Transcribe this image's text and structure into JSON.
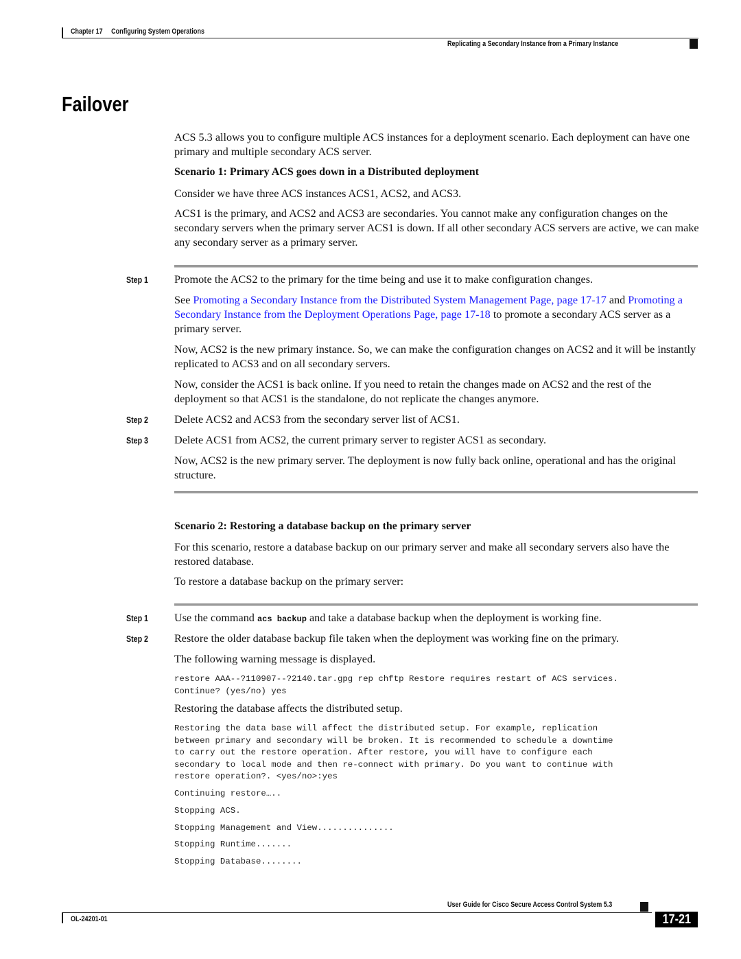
{
  "header": {
    "chapter": "Chapter 17",
    "chapter_title": "Configuring System Operations",
    "section_title": "Replicating a Secondary Instance from a Primary Instance"
  },
  "title": "Failover",
  "intro": "ACS 5.3 allows you to configure multiple ACS instances for a deployment scenario. Each deployment can have one primary and multiple secondary ACS server.",
  "scenario1": {
    "heading": "Scenario 1: Primary ACS goes down in a Distributed deployment",
    "p1": "Consider we have three ACS instances ACS1, ACS2, and ACS3.",
    "p2": "ACS1 is the primary, and ACS2 and ACS3 are secondaries. You cannot make any configuration changes on the secondary servers when the primary server ACS1 is down. If all other secondary ACS servers are active, we can make any secondary server as a primary server.",
    "steps": [
      {
        "label": "Step 1",
        "text": "Promote the ACS2 to the primary for the time being and use it to make configuration changes."
      },
      {
        "label": "Step 2",
        "text": "Delete ACS2 and ACS3 from the secondary server list of ACS1."
      },
      {
        "label": "Step 3",
        "text": "Delete ACS1 from ACS2, the current primary server to register ACS1 as secondary."
      }
    ],
    "see_prefix": "See ",
    "link1": "Promoting a Secondary Instance from the Distributed System Management Page, page 17-17",
    "see_and": " and ",
    "link2": "Promoting a Secondary Instance from the Deployment Operations Page, page 17-18",
    "see_suffix": " to promote a secondary ACS server as a primary server.",
    "p_now1": "Now, ACS2 is the new primary instance. So, we can make the configuration changes on ACS2 and it will be instantly replicated to ACS3 and on all secondary servers.",
    "p_now2": "Now, consider the ACS1 is back online. If you need to retain the changes made on ACS2 and the rest of the deployment so that ACS1 is the standalone, do not replicate the changes anymore.",
    "p_final": "Now, ACS2 is the new primary server. The deployment is now fully back online, operational and has the original structure."
  },
  "scenario2": {
    "heading": "Scenario 2: Restoring a database backup on the primary server",
    "p1": "For this scenario, restore a database backup on our primary server and make all secondary servers also have the restored database.",
    "p2": "To restore a database backup on the primary server:",
    "steps": [
      {
        "label": "Step 1",
        "text_before": "Use the command ",
        "code": "acs backup",
        "text_after": " and take a database backup when the deployment is working fine."
      },
      {
        "label": "Step 2",
        "text": "Restore the older database backup file taken when the deployment was working fine on the primary."
      }
    ],
    "warning_intro": "The following warning message is displayed.",
    "code1": "restore AAA--?110907--?2140.tar.gpg rep chftp Restore requires restart of ACS services.\nContinue? (yes/no) yes",
    "restoring_text": "Restoring the database affects the distributed setup.",
    "code2": "Restoring the data base will affect the distributed setup. For example, replication\nbetween primary and secondary will be broken. It is recommended to schedule a downtime\nto carry out the restore operation. After restore, you will have to configure each\nsecondary to local mode and then re-connect with primary. Do you want to continue with\nrestore operation?. <yes/no>:yes",
    "output_lines": [
      "Continuing restore…..",
      "Stopping ACS.",
      "Stopping Management and View...............",
      "Stopping Runtime.......",
      "Stopping Database........"
    ]
  },
  "footer": {
    "guide_title": "User Guide for Cisco Secure Access Control System 5.3",
    "doc_id": "OL-24201-01",
    "page_number": "17-21"
  }
}
